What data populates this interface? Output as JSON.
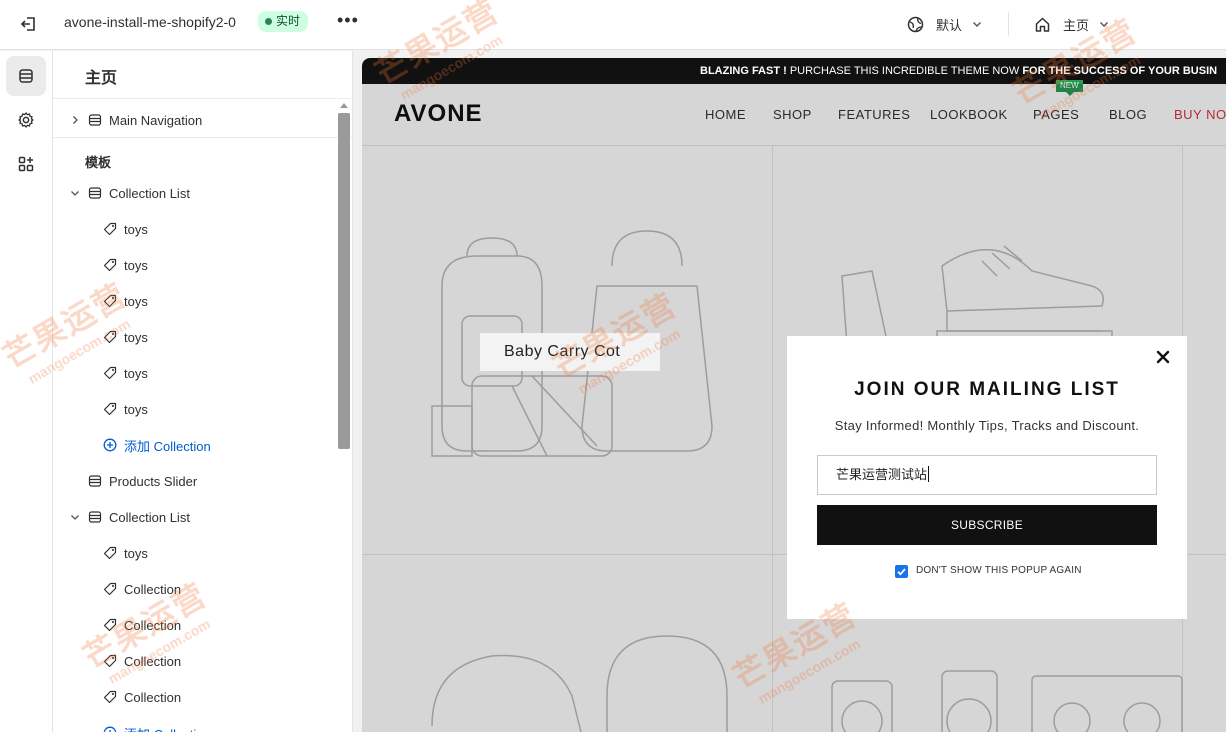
{
  "topbar": {
    "store_name": "avone-install-me-shopify2-0",
    "status_badge": "实时",
    "language": "默认",
    "page": "主页"
  },
  "sidebar": {
    "title": "主页",
    "main_navigation": "Main Navigation",
    "section_title": "模板",
    "groups": [
      {
        "label": "Collection List",
        "items": [
          "toys",
          "toys",
          "toys",
          "toys",
          "toys",
          "toys"
        ],
        "add_label": "添加 Collection"
      },
      {
        "label": "Products Slider"
      },
      {
        "label": "Collection List",
        "items": [
          "toys",
          "Collection",
          "Collection",
          "Collection",
          "Collection"
        ],
        "add_label": "添加 Collection"
      }
    ]
  },
  "preview": {
    "announcement": {
      "part1": "BLAZING FAST !",
      "part2": " PURCHASE THIS INCREDIBLE THEME NOW ",
      "part3": "FOR THE SUCCESS OF YOUR BUSIN"
    },
    "logo": "AVONE",
    "menu": [
      "HOME",
      "SHOP",
      "FEATURES",
      "LOOKBOOK",
      "PAGES",
      "BLOG",
      "BUY NOW"
    ],
    "new_tag": "NEW",
    "product_label": "Baby Carry Cot"
  },
  "popup": {
    "title": "JOIN OUR MAILING LIST",
    "subtitle": "Stay Informed! Monthly Tips, Tracks and Discount.",
    "input_value": "芒果运营测试站",
    "button_label": "SUBSCRIBE",
    "checkbox_label": "DON'T SHOW THIS POPUP AGAIN",
    "checkbox_checked": true
  },
  "watermark": {
    "main": "芒果运营",
    "sub": "mangoecom.com"
  },
  "colors": {
    "accent": "#005bd3",
    "live_badge_bg": "#cdfee1",
    "buy_now": "#d9343e",
    "new_tag": "#2a9d55"
  }
}
